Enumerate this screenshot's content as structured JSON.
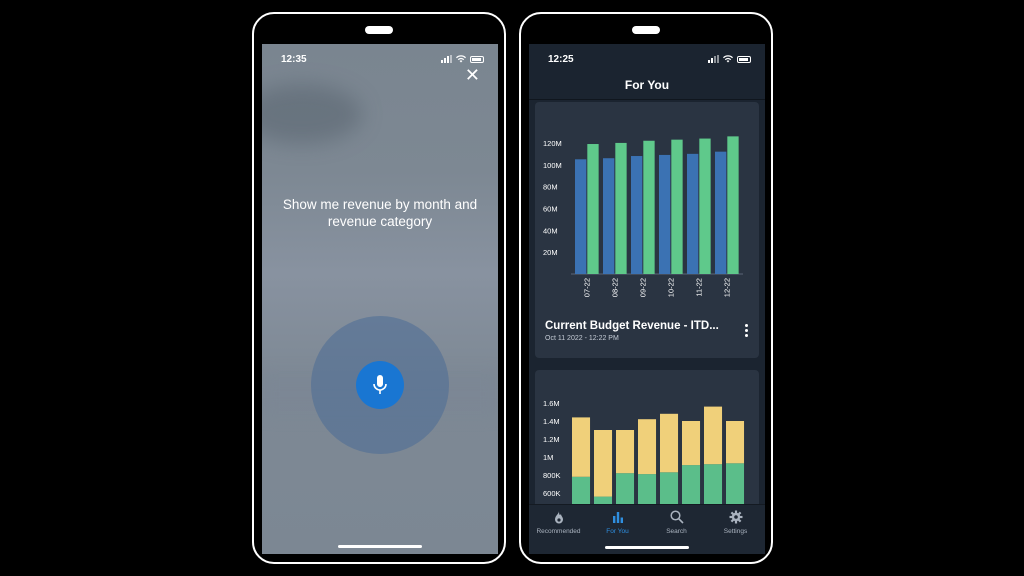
{
  "left": {
    "status_time": "12:35",
    "prompt": "Show me revenue by month and revenue category",
    "close_glyph": "✕",
    "mic_icon": "microphone-icon"
  },
  "right": {
    "status_time": "12:25",
    "title": "For You",
    "card1": {
      "title": "Current Budget Revenue - ITD...",
      "date": "Oct 11 2022 - 12:22 PM"
    },
    "tabs": [
      {
        "label": "Recommended",
        "icon": "flame-icon",
        "active": false
      },
      {
        "label": "For You",
        "icon": "bar-chart-icon",
        "active": true
      },
      {
        "label": "Search",
        "icon": "search-icon",
        "active": false
      },
      {
        "label": "Settings",
        "icon": "gear-icon",
        "active": false
      }
    ]
  },
  "colors": {
    "blue_bar": "#3b72b3",
    "green_bar": "#5fc98b",
    "yellow_bar": "#f0d07a",
    "green_bar2": "#5bbe8a",
    "active_tab": "#2f8fe0",
    "mic": "#1976d2"
  },
  "chart_data": [
    {
      "type": "bar",
      "categories": [
        "07-22",
        "08-22",
        "09-22",
        "10-22",
        "11-22",
        "12-22"
      ],
      "series": [
        {
          "values": [
            105,
            106,
            108,
            109,
            110,
            112
          ]
        },
        {
          "values": [
            119,
            120,
            122,
            123,
            124,
            126
          ]
        }
      ],
      "ytick_labels": [
        "20M",
        "40M",
        "60M",
        "80M",
        "100M",
        "120M"
      ],
      "ytick_values": [
        20,
        40,
        60,
        80,
        100,
        120
      ],
      "ylim": [
        0,
        130
      ]
    },
    {
      "type": "bar",
      "stacked": true,
      "categories": [
        "",
        "",
        "",
        "",
        "",
        "",
        "",
        ""
      ],
      "series": [
        {
          "values": [
            780,
            560,
            820,
            810,
            830,
            910,
            920,
            930
          ]
        },
        {
          "values": [
            660,
            740,
            480,
            610,
            650,
            490,
            640,
            470
          ]
        }
      ],
      "ytick_labels": [
        "600K",
        "800K",
        "1M",
        "1.2M",
        "1.4M",
        "1.6M"
      ],
      "ytick_values": [
        600,
        800,
        1000,
        1200,
        1400,
        1600
      ],
      "ylim": [
        500,
        1700
      ]
    }
  ]
}
